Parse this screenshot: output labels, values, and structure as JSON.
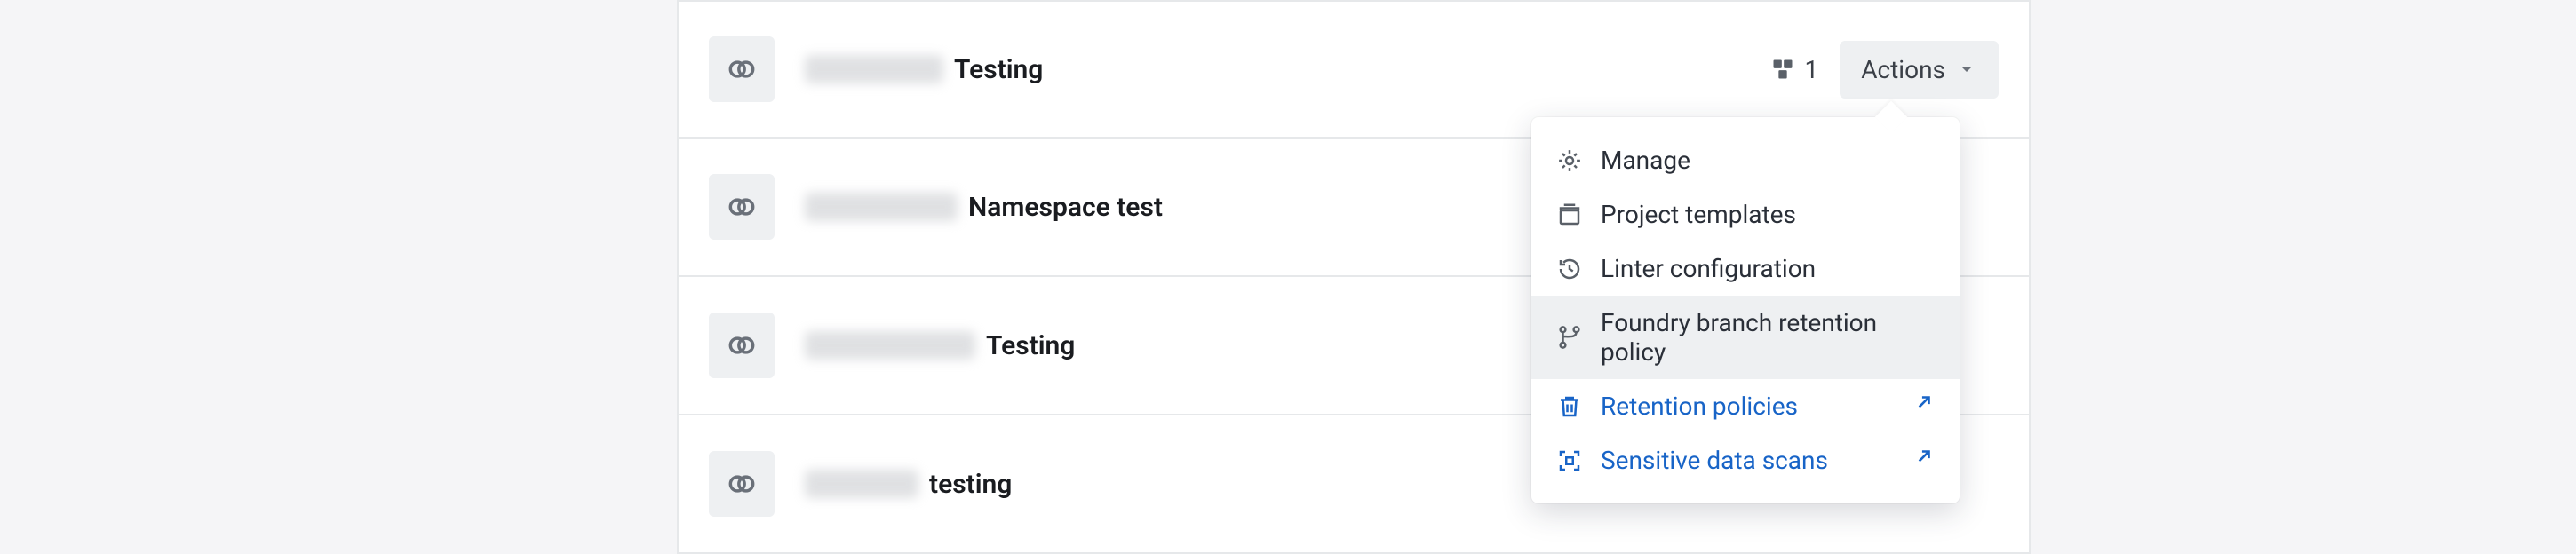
{
  "rows": [
    {
      "label": "Testing",
      "blur_width": 156,
      "count": "1",
      "show_actions": true
    },
    {
      "label": "Namespace test",
      "blur_width": 172
    },
    {
      "label": "Testing",
      "blur_width": 192
    },
    {
      "label": "testing",
      "blur_width": 128
    }
  ],
  "actions_button": {
    "label": "Actions"
  },
  "menu": {
    "items": [
      {
        "name": "manage",
        "label": "Manage",
        "icon": "gear"
      },
      {
        "name": "project-templates",
        "label": "Project templates",
        "icon": "templates"
      },
      {
        "name": "linter-configuration",
        "label": "Linter configuration",
        "icon": "history"
      },
      {
        "name": "foundry-branch-retention-policy",
        "label": "Foundry branch retention policy",
        "icon": "branch",
        "highlight": true
      },
      {
        "name": "retention-policies",
        "label": "Retention policies",
        "icon": "trash",
        "link": true,
        "external": true
      },
      {
        "name": "sensitive-data-scans",
        "label": "Sensitive data scans",
        "icon": "scan",
        "link": true,
        "external": true
      }
    ]
  }
}
